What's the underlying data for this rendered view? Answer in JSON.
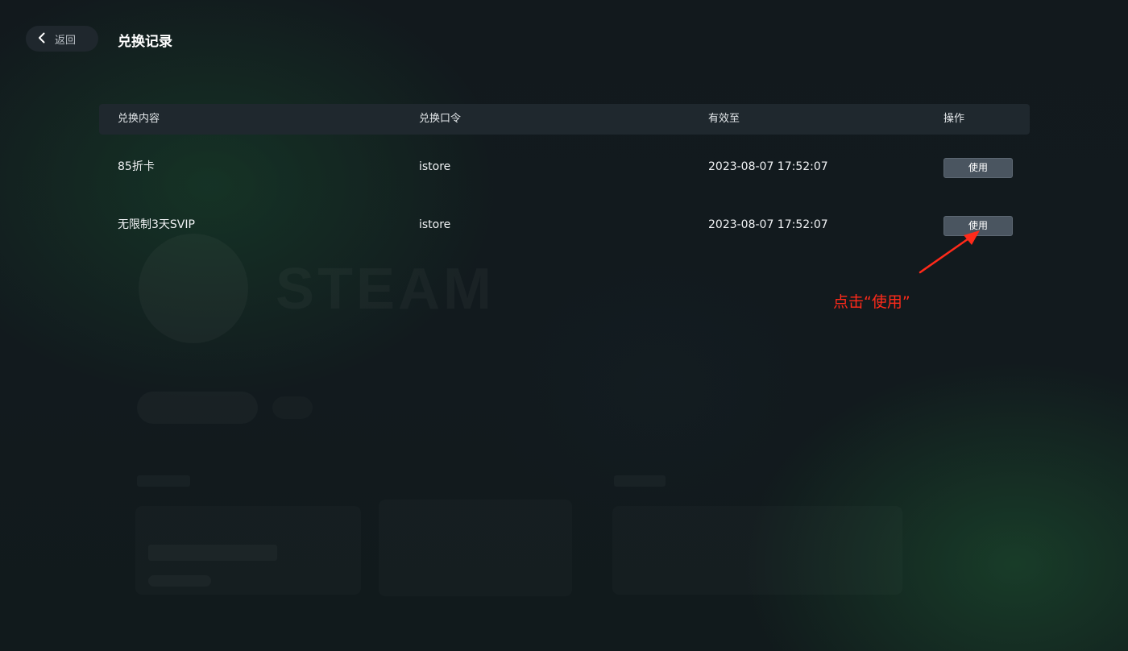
{
  "header": {
    "back_label": "返回",
    "title": "兑换记录"
  },
  "table": {
    "columns": [
      "兑换内容",
      "兑换口令",
      "有效至",
      "操作"
    ],
    "rows": [
      {
        "content": "85折卡",
        "code": "istore",
        "expires": "2023-08-07 17:52:07",
        "action": "使用"
      },
      {
        "content": "无限制3天SVIP",
        "code": "istore",
        "expires": "2023-08-07 17:52:07",
        "action": "使用"
      }
    ]
  },
  "annotation": {
    "text": "点击“使用”",
    "color": "#ff2a1a"
  },
  "background": {
    "watermark_text": "STEAM"
  },
  "icons": {
    "back": "chevron-left-icon"
  },
  "colors": {
    "background": "#12191d",
    "header_row": "#1f282e",
    "button": "#4a5560"
  }
}
